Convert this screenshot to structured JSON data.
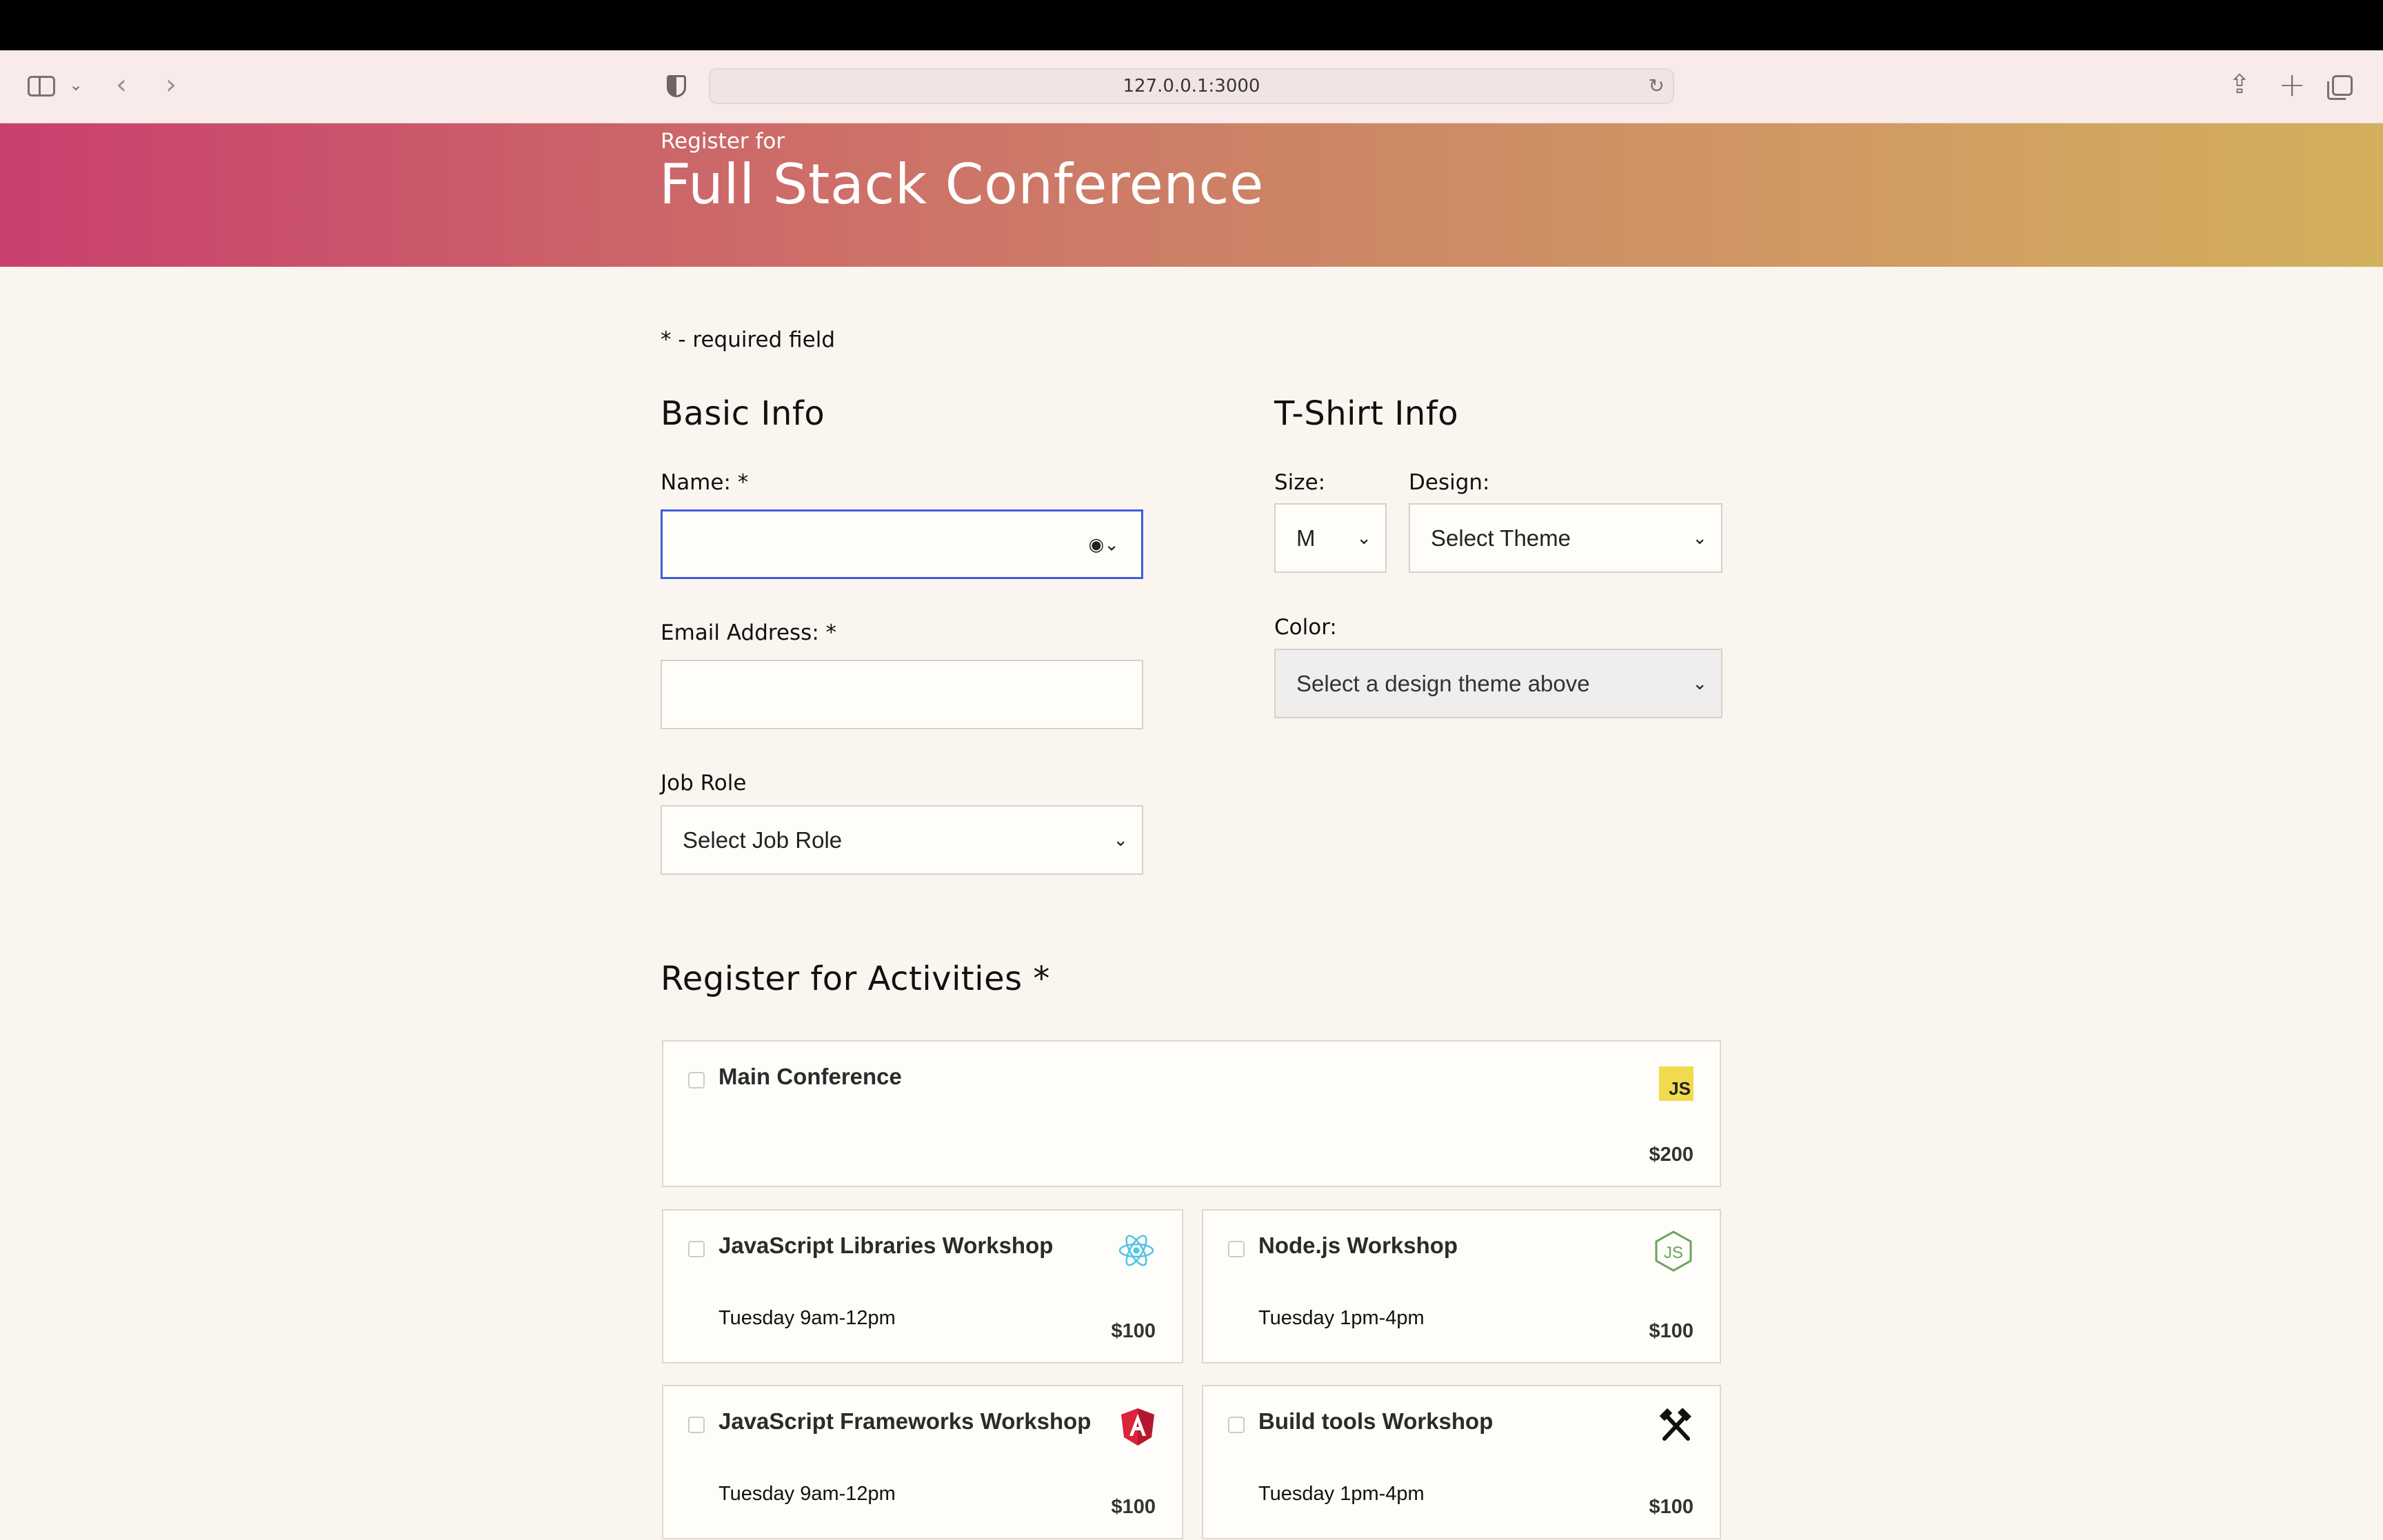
{
  "browser": {
    "url": "127.0.0.1:3000"
  },
  "hero": {
    "kicker": "Register for",
    "title": "Full Stack Conference"
  },
  "form": {
    "required_note": "* - required field",
    "basic": {
      "heading": "Basic Info",
      "name_label": "Name: *",
      "name_value": "",
      "email_label": "Email Address: *",
      "email_value": "",
      "job_label": "Job Role",
      "job_value": "Select Job Role"
    },
    "tshirt": {
      "heading": "T-Shirt Info",
      "size_label": "Size:",
      "size_value": "M",
      "design_label": "Design:",
      "design_value": "Select Theme",
      "color_label": "Color:",
      "color_value": "Select a design theme above"
    },
    "activities": {
      "heading": "Register for Activities *",
      "items": [
        {
          "title": "Main Conference",
          "time": "",
          "cost": "$200",
          "icon": "javascript-logo-icon"
        },
        {
          "title": "JavaScript Libraries Workshop",
          "time": "Tuesday 9am-12pm",
          "cost": "$100",
          "icon": "react-logo-icon"
        },
        {
          "title": "Node.js Workshop",
          "time": "Tuesday 1pm-4pm",
          "cost": "$100",
          "icon": "nodejs-logo-icon"
        },
        {
          "title": "JavaScript Frameworks Workshop",
          "time": "Tuesday 9am-12pm",
          "cost": "$100",
          "icon": "angular-logo-icon"
        },
        {
          "title": "Build tools Workshop",
          "time": "Tuesday 1pm-4pm",
          "cost": "$100",
          "icon": "build-tools-icon"
        }
      ],
      "js_logo_text": "JS"
    }
  },
  "colors": {
    "hero_start": "#c9406e",
    "hero_end": "#d3b05d",
    "focus_border": "#3f5ddb",
    "page_bg": "#faf6ef"
  }
}
